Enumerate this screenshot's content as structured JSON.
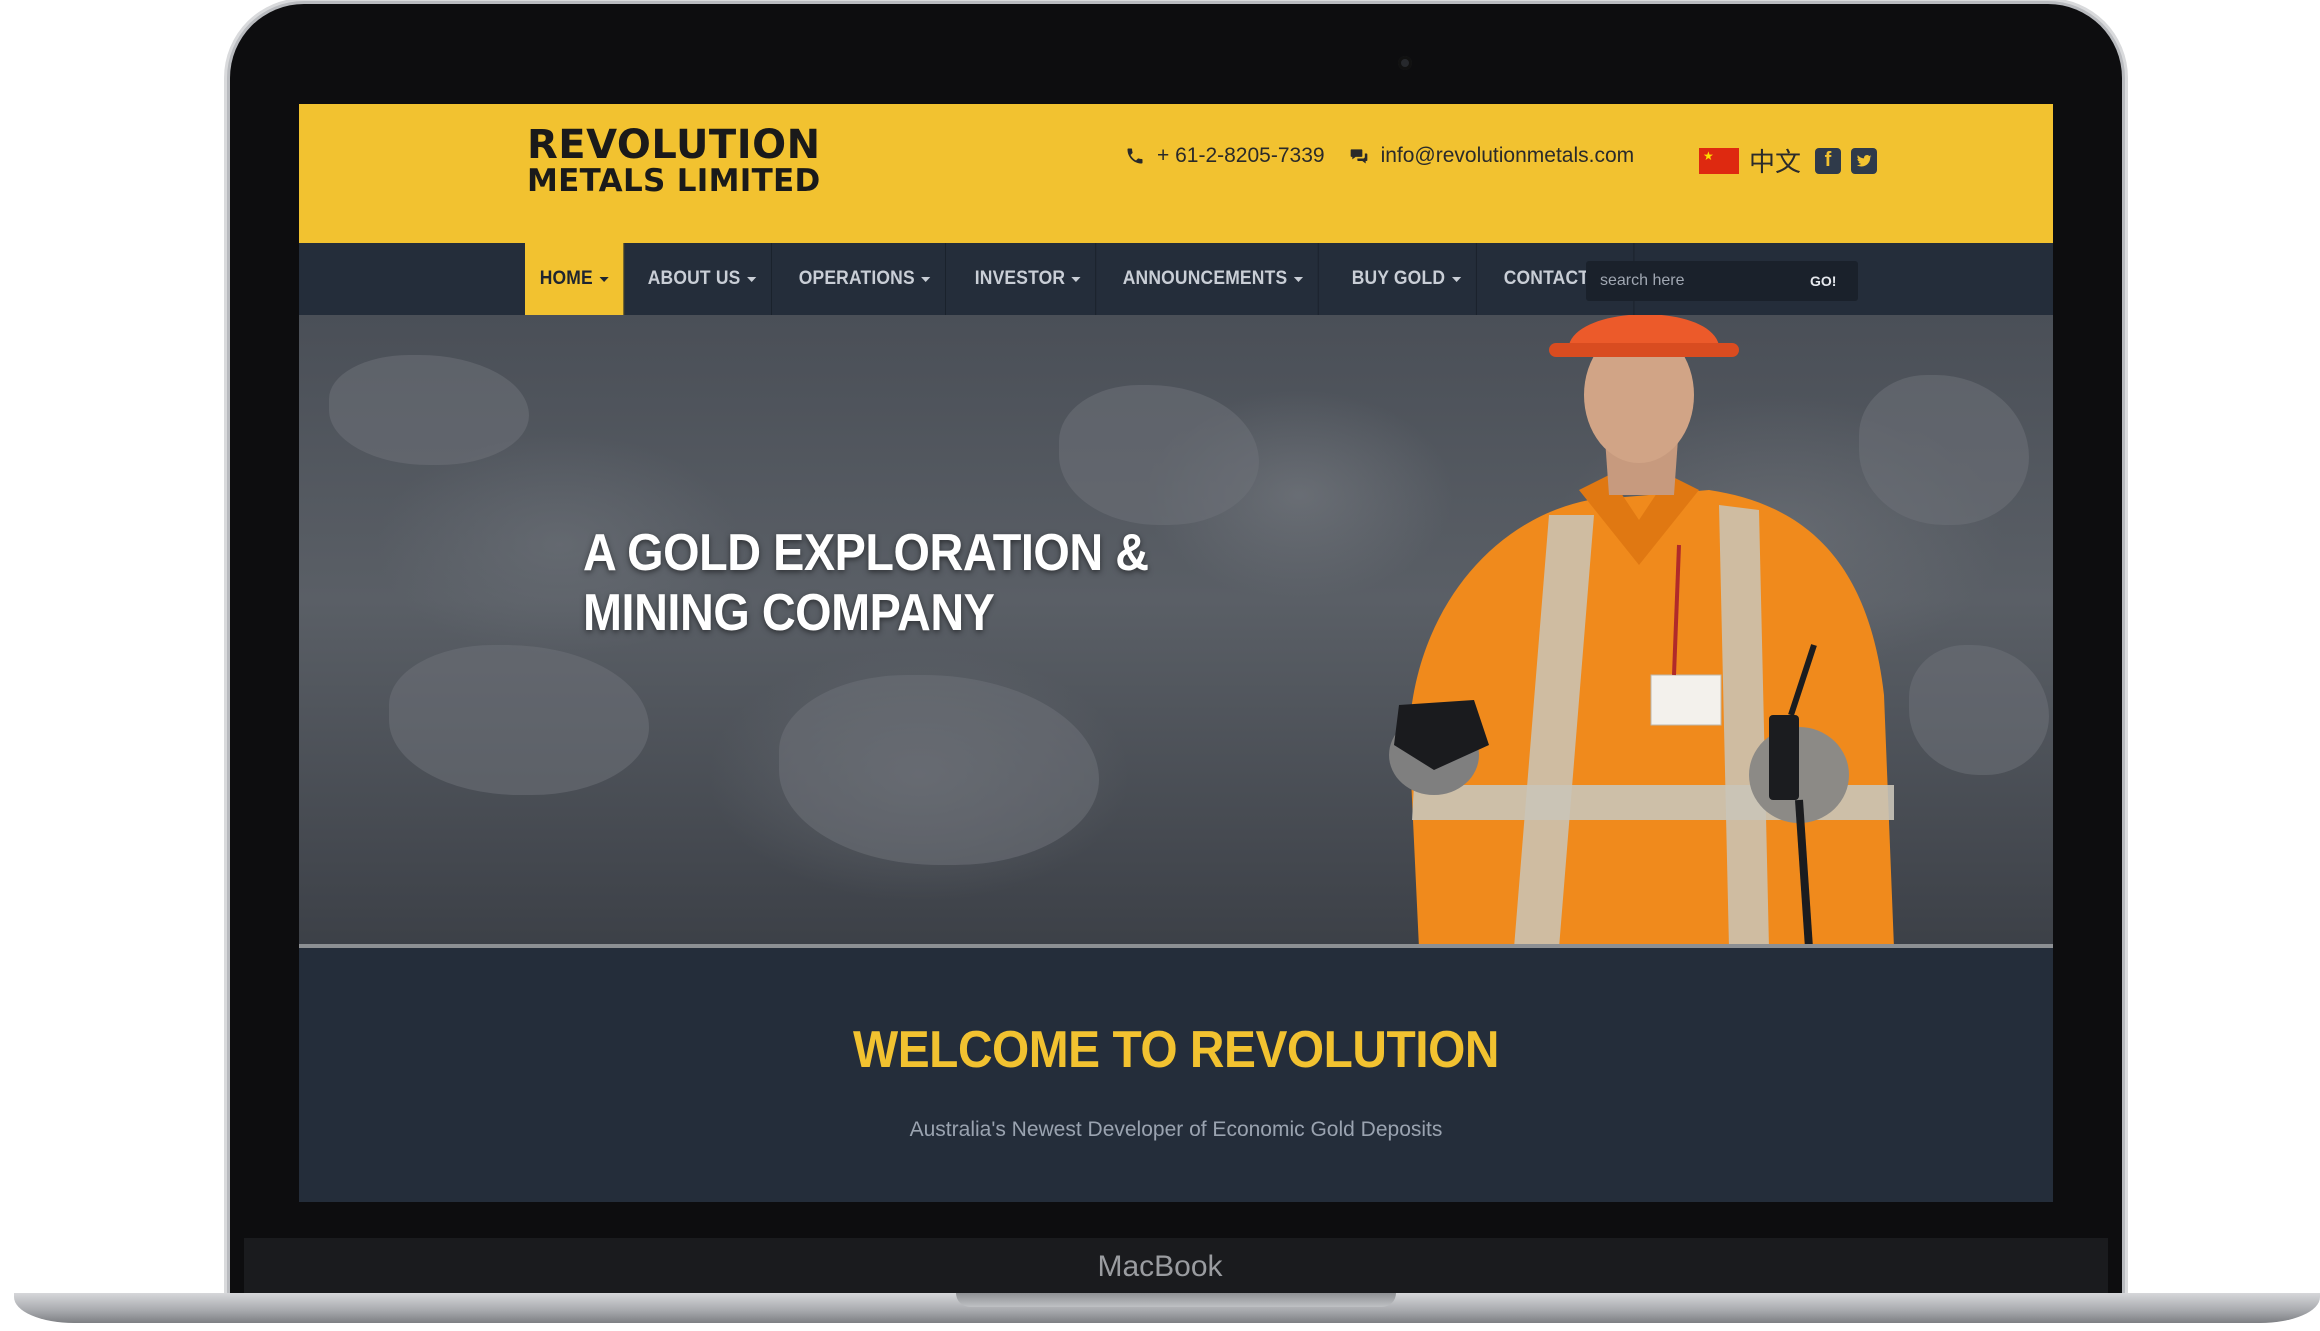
{
  "device": {
    "brand": "MacBook"
  },
  "header": {
    "logo_line1": "REVOLUTION",
    "logo_line2": "METALS LIMITED",
    "phone": "+ 61-2-8205-7339",
    "email": "info@revolutionmetals.com",
    "language_label": "中文"
  },
  "nav": {
    "items": [
      {
        "label": "HOME",
        "dropdown": true,
        "active": true
      },
      {
        "label": "ABOUT US",
        "dropdown": true
      },
      {
        "label": "OPERATIONS",
        "dropdown": true
      },
      {
        "label": "INVESTOR",
        "dropdown": true
      },
      {
        "label": "ANNOUNCEMENTS",
        "dropdown": true
      },
      {
        "label": "BUY GOLD",
        "dropdown": true
      },
      {
        "label": "CONTACT US",
        "dropdown": false
      }
    ],
    "search": {
      "placeholder": "search here",
      "button_label": "GO!"
    }
  },
  "hero": {
    "title_line1": "A GOLD EXPLORATION &",
    "title_line2": "MINING COMPANY"
  },
  "welcome": {
    "title": "WELCOME TO REVOLUTION",
    "subtitle": "Australia's Newest Developer of Economic Gold Deposits"
  },
  "colors": {
    "brand_yellow": "#f2c230",
    "nav_dark": "#242d3a",
    "welcome_text": "#9aa3b0"
  },
  "icons": [
    "phone-icon",
    "chat-icon",
    "china-flag-icon",
    "facebook-icon",
    "twitter-icon"
  ]
}
